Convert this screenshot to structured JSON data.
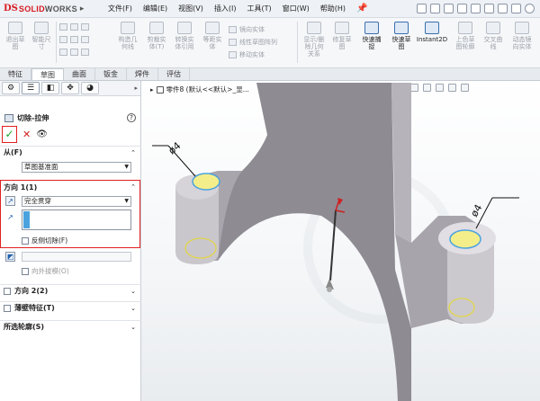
{
  "app": {
    "logo_mark": "DS",
    "logo_solid": "SOLID",
    "logo_works": "WORKS",
    "menu": [
      "文件(F)",
      "编辑(E)",
      "视图(V)",
      "插入(I)",
      "工具(T)",
      "窗口(W)",
      "帮助(H)"
    ]
  },
  "ribbon": {
    "exit_sketch": "退出草\n图",
    "smart_dim": "智能尺\n寸",
    "construct": "构造几\n何线",
    "trim": "剪裁实\n体(T)",
    "convert": "转换实\n体引用",
    "offset": "等距实\n体",
    "mirror": "镜向实体",
    "linear_pattern": "线性草图阵列",
    "move": "移动实体",
    "relations": "显示/删\n除几何\n关系",
    "repair": "修复草\n图",
    "snap": "快速捕\n捉",
    "rapid_sketch": "快速草\n图",
    "instant2d": "Instant2D",
    "shaded": "上色草\n图轮廓",
    "cross": "交叉曲\n线",
    "dynamic": "动态镜\n向实体"
  },
  "tabs": [
    "特征",
    "草图",
    "曲面",
    "钣金",
    "焊件",
    "评估"
  ],
  "panel": {
    "tab_icons": [
      "⚙",
      "☰",
      "◧",
      "✥",
      "◕"
    ],
    "feature_title": "切除-拉伸",
    "help": "?",
    "ok": "✓",
    "cancel": "✕",
    "eye": "👁",
    "from_header": "从(F)",
    "from_value": "草图基准面",
    "dir1_header": "方向 1(1)",
    "dir1_value": "完全贯穿",
    "flip_label": "反侧切除(F)",
    "outward_draft": "向外拔模(O)",
    "dir2_header": "方向 2(2)",
    "thin_header": "薄壁特征(T)",
    "contours_header": "所选轮廓(S)"
  },
  "viewport": {
    "tree_label": "零件8 (默认<<默认>_显..."
  },
  "dimensions": {
    "left": "ø4",
    "right": "ø4"
  },
  "colors": {
    "accent_red": "#e02020",
    "ok_green": "#1aa32a",
    "model_gray": "#8e8b93",
    "model_light": "#c9c6cc",
    "highlight_yellow": "#f4ee8a",
    "selection_blue": "#4aa3df"
  }
}
